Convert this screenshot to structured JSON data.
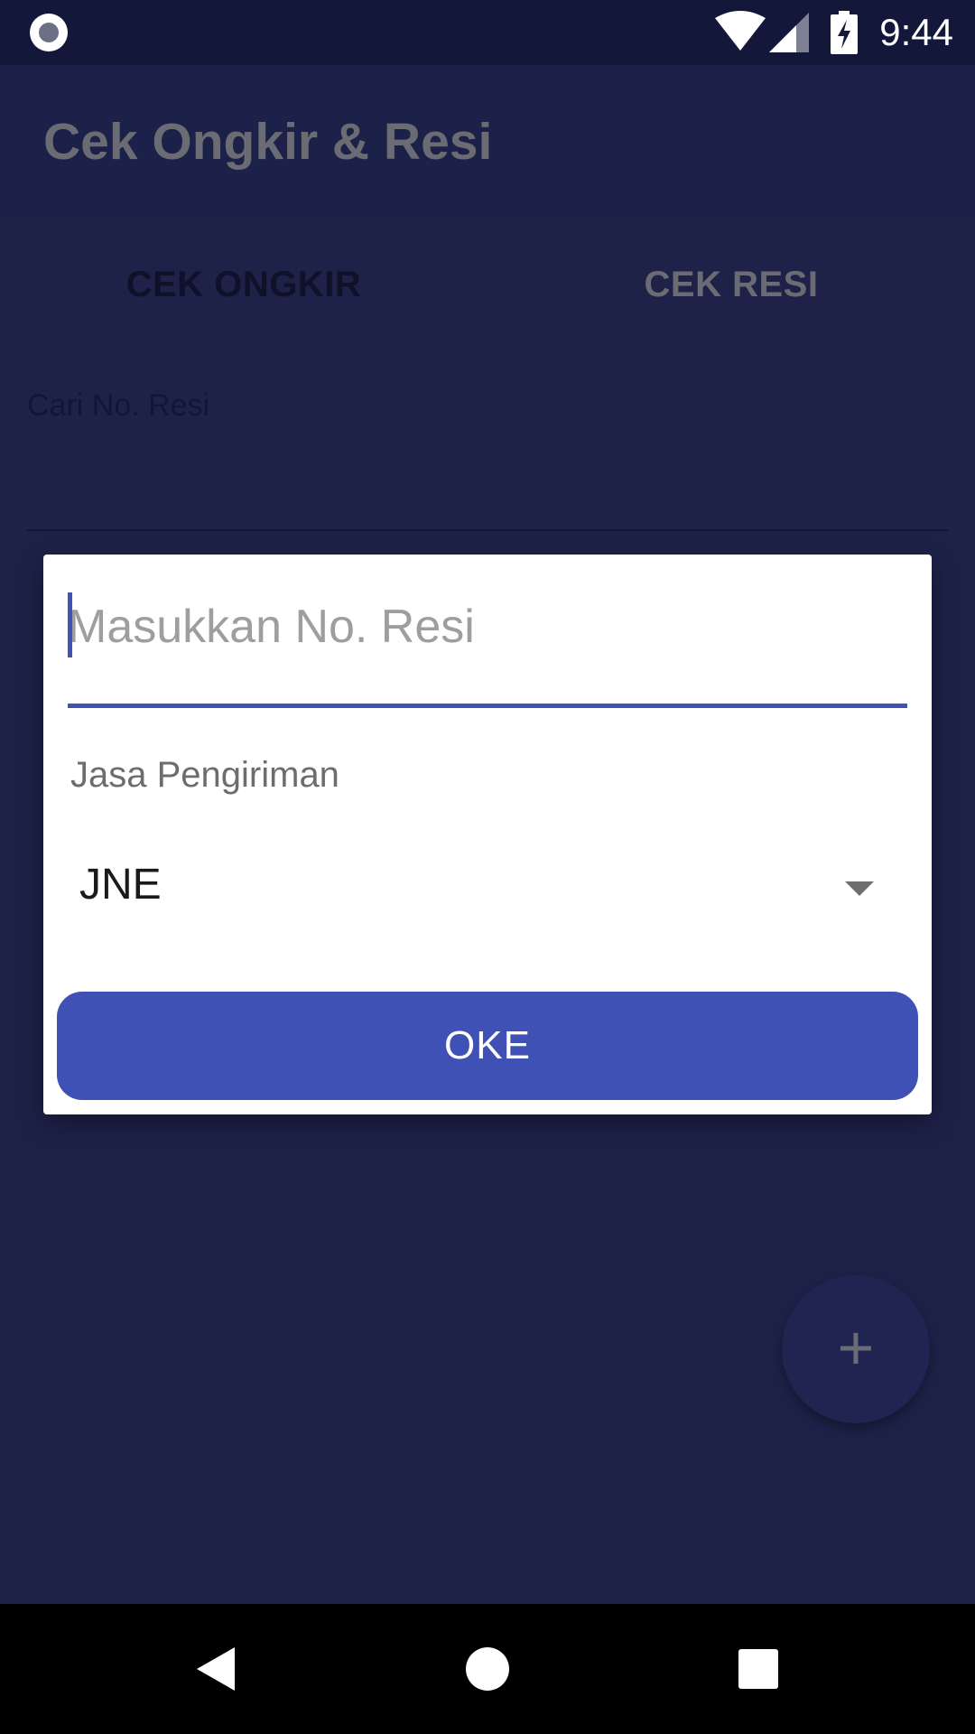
{
  "status_bar": {
    "time": "9:44",
    "icons": [
      "record-icon",
      "wifi-icon",
      "cell-signal-icon",
      "battery-charging-icon"
    ]
  },
  "app_bar": {
    "title": "Cek Ongkir & Resi"
  },
  "tabs": [
    {
      "label": "CEK ONGKIR",
      "selected": true
    },
    {
      "label": "CEK RESI",
      "selected": false
    }
  ],
  "background_form": {
    "search_label": "Cari No. Resi"
  },
  "fab": {
    "icon": "plus-icon",
    "glyph": "+"
  },
  "dialog": {
    "resi_input": {
      "value": "",
      "placeholder": "Masukkan No. Resi"
    },
    "courier": {
      "label": "Jasa Pengiriman",
      "selected": "JNE",
      "icon": "dropdown-arrow-icon"
    },
    "submit_label": "OKE"
  },
  "colors": {
    "accent": "#3f51b5",
    "scrim_background": "#1e2249",
    "status_bar": "#131739",
    "dialog": "#ffffff"
  },
  "nav_bar": {
    "icons": [
      "back-icon",
      "home-icon",
      "recents-icon"
    ]
  }
}
